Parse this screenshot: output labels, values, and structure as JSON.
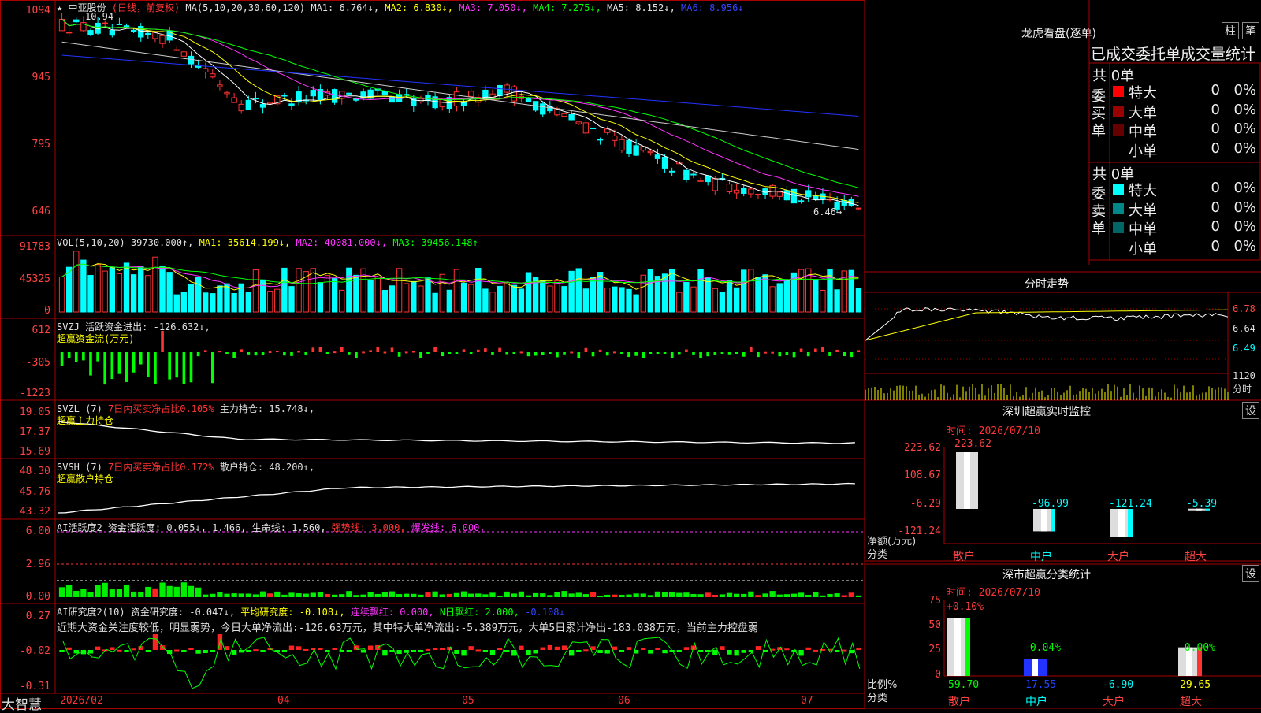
{
  "app": {
    "name": "大智慧"
  },
  "kline": {
    "title_star": "★",
    "stock": "中亚股份",
    "period": "(日线，前复权)",
    "ma_label": "MA(5,10,20,30,60,120)",
    "ma1": "MA1: 6.764↓,",
    "ma2": "MA2: 6.830↓,",
    "ma3": "MA3: 7.050↓,",
    "ma4": "MA4: 7.275↓,",
    "ma5": "MA5: 8.152↓,",
    "ma6": "MA6: 8.956↓",
    "y_ticks": [
      "1094",
      "945",
      "795",
      "646"
    ],
    "high_label": "10.94",
    "low_label": "6.46→"
  },
  "vol": {
    "label": "VOL(5,10,20)",
    "value": "39730.000↑,",
    "ma1": "MA1: 35614.199↓,",
    "ma2": "MA2: 40081.000↓,",
    "ma3": "MA3: 39456.148↑",
    "y_ticks": [
      "91783",
      "45325",
      "0"
    ]
  },
  "svzj": {
    "label": "SVZJ",
    "desc": "活跃资金进出: -126.632↓,",
    "sub": "超赢资金流(万元)",
    "y_ticks": [
      "612",
      "-305",
      "-1223"
    ]
  },
  "svzl": {
    "label": "SVZL (7)",
    "desc": "7日内买卖净占比0.105%",
    "desc2": "主力持仓: 15.748↓,",
    "sub": "超赢主力持仓",
    "y_ticks": [
      "19.05",
      "17.37",
      "15.69"
    ]
  },
  "svsh": {
    "label": "SVSH (7)",
    "desc": "7日内买卖净占比0.172%",
    "desc2": "散户持仓: 48.200↑,",
    "sub": "超赢散户持仓",
    "y_ticks": [
      "48.30",
      "45.76",
      "43.32"
    ]
  },
  "ai_active": {
    "label": "AI活跃度2",
    "desc": "资金活跃度: 0.055↓, 1.466, 生命线: 1.560,",
    "strong": "强势线: 3.000,",
    "burst": "爆发线: 6.000,",
    "y_ticks": [
      "6.00",
      "2.96",
      "0.00"
    ]
  },
  "ai_research": {
    "label": "AI研究度2(10)",
    "desc": "资金研究度: -0.047↓,",
    "avg": "平均研究度: -0.108↓,",
    "streak": "连续飘红: 0.000,",
    "nday": "N日飘红: 2.000,",
    "last": "-0.108↓",
    "commentary": "近期大资金关注度较低，明显弱势，今日大单净流出:-126.63万元，其中特大单净流出:-5.389万元，大单5日累计净出-183.038万元，当前主力控盘弱",
    "y_ticks": [
      "0.27",
      "-0.02",
      "-0.31"
    ]
  },
  "x_axis": {
    "labels": [
      "2026/02",
      "04",
      "05",
      "06",
      "07"
    ]
  },
  "right": {
    "dragon_title": "龙虎看盘(逐单)",
    "btn_zhu": "柱",
    "btn_bi": "笔",
    "stats_title": "已成交委托单成交量统计",
    "buy_label": "委买单",
    "sell_label": "委卖单",
    "buy_total": "共 0单",
    "sell_total": "共 0单",
    "buy_rows": [
      {
        "name": "特大",
        "count": "0",
        "pct": "0%",
        "color": "#ff0000"
      },
      {
        "name": "大单",
        "count": "0",
        "pct": "0%",
        "color": "#990000"
      },
      {
        "name": "中单",
        "count": "0",
        "pct": "0%",
        "color": "#660000"
      },
      {
        "name": "小单",
        "count": "0",
        "pct": "0%",
        "color": ""
      }
    ],
    "sell_rows": [
      {
        "name": "特大",
        "count": "0",
        "pct": "0%",
        "color": "#00ffff"
      },
      {
        "name": "大单",
        "count": "0",
        "pct": "0%",
        "color": "#008888"
      },
      {
        "name": "中单",
        "count": "0",
        "pct": "0%",
        "color": "#006666"
      },
      {
        "name": "小单",
        "count": "0",
        "pct": "0%",
        "color": ""
      }
    ],
    "intraday_title": "分时走势",
    "intraday_prices": [
      "6.78",
      "6.64",
      "6.49"
    ],
    "intraday_vol": [
      "1120",
      "分时"
    ],
    "monitor_title": "深圳超赢实时监控",
    "monitor_btn": "设",
    "monitor_time": "时间: 2026/07/10",
    "monitor_y": [
      "223.62",
      "108.67",
      "-6.29",
      "-121.24"
    ],
    "monitor_ylabel": "净额(万元)",
    "monitor_xlabel": "分类",
    "monitor_values": [
      "223.62",
      "-96.99",
      "-121.24",
      "-5.39"
    ],
    "monitor_cats": [
      "散户",
      "中户",
      "大户",
      "超大"
    ],
    "class_title": "深市超赢分类统计",
    "class_btn": "设",
    "class_time": "时间: 2026/07/10",
    "class_y": [
      "75",
      "50",
      "25",
      "0"
    ],
    "class_ylabel": "比例%",
    "class_xlabel": "分类",
    "class_top": [
      "+0.10%",
      "-0.04%",
      "",
      "-0.00%"
    ],
    "class_values": [
      "59.70",
      "17.55",
      "-6.90",
      "29.65"
    ],
    "class_cats": [
      "散户",
      "中户",
      "大户",
      "超大"
    ]
  }
}
